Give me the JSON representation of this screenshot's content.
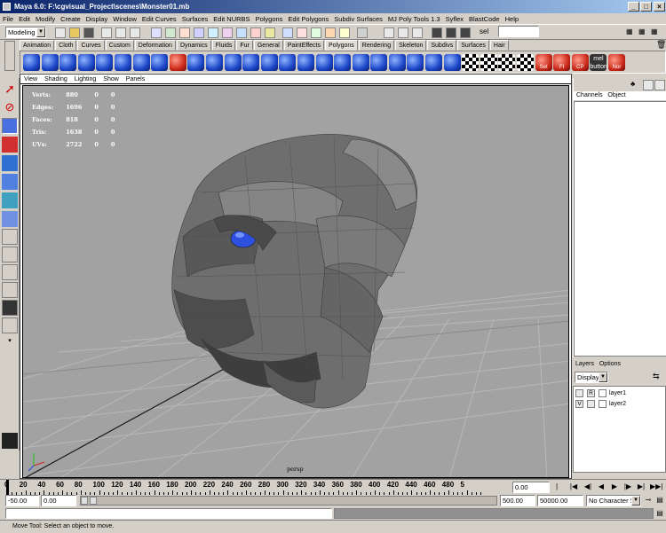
{
  "window": {
    "title": "Maya 6.0: F:\\cgvisual_Project\\scenes\\Monster01.mb",
    "controls": [
      "_",
      "□",
      "×"
    ]
  },
  "menubar": [
    "File",
    "Edit",
    "Modify",
    "Create",
    "Display",
    "Window",
    "Edit Curves",
    "Surfaces",
    "Edit NURBS",
    "Polygons",
    "Edit Polygons",
    "Subdiv Surfaces",
    "MJ Poly Tools 1.3",
    "Syflex",
    "BlastCode",
    "Help"
  ],
  "status": {
    "menu_set": "Modeling",
    "sel_label": "sel"
  },
  "shelf_tabs": [
    "Animation",
    "Cloth",
    "Curves",
    "Custom",
    "Deformation",
    "Dynamics",
    "Fluids",
    "Fur",
    "General",
    "PaintEffects",
    "Polygons",
    "Rendering",
    "Skeleton",
    "Subdivs",
    "Surfaces",
    "Hair"
  ],
  "active_shelf_tab": "Polygons",
  "shelf_labels": {
    "set": "Set",
    "fi": "FI",
    "cp": "CP",
    "mel": "mel button",
    "nor": "Nor"
  },
  "viewport": {
    "menu": [
      "View",
      "Shading",
      "Lighting",
      "Show",
      "Panels"
    ],
    "hud": [
      {
        "label": "Verts:",
        "a": "880",
        "b": "0",
        "c": "0"
      },
      {
        "label": "Edges:",
        "a": "1696",
        "b": "0",
        "c": "0"
      },
      {
        "label": "Faces:",
        "a": "818",
        "b": "0",
        "c": "0"
      },
      {
        "label": "Tris:",
        "a": "1638",
        "b": "0",
        "c": "0"
      },
      {
        "label": "UVs:",
        "a": "2722",
        "b": "0",
        "c": "0"
      }
    ],
    "camera": "persp"
  },
  "channel_box": {
    "menu": [
      "Channels",
      "Object"
    ]
  },
  "layer_editor": {
    "menu": [
      "Layers",
      "Options"
    ],
    "display_option": "Display",
    "layers": [
      {
        "vis": "",
        "type": "R",
        "name": "layer1"
      },
      {
        "vis": "V",
        "type": "",
        "name": "layer2"
      }
    ]
  },
  "timeline": {
    "ticks": [
      "0",
      "20",
      "40",
      "60",
      "80",
      "100",
      "120",
      "140",
      "160",
      "180",
      "200",
      "220",
      "240",
      "260",
      "280",
      "300",
      "320",
      "340",
      "360",
      "380",
      "400",
      "420",
      "440",
      "460",
      "480",
      "5"
    ],
    "current_frame": "0.00"
  },
  "range": {
    "start": "-50.00",
    "inner_start": "0.00",
    "inner_end": "500.00",
    "end": "50000.00",
    "character_set": "No Character Set"
  },
  "help_line": "Move Tool: Select an object to move."
}
